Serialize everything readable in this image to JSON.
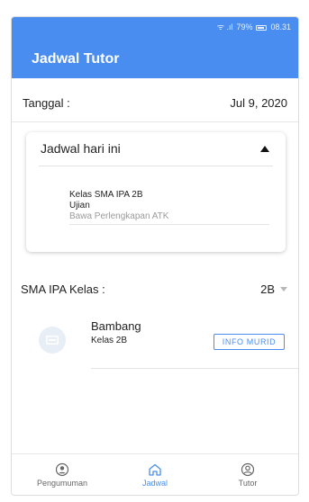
{
  "status_bar": {
    "signal_text": "ᯤ .ıl",
    "battery_percent": "79%",
    "time": "08.31"
  },
  "app_bar": {
    "title": "Jadwal Tutor"
  },
  "date_row": {
    "label": "Tanggal :",
    "value": "Jul 9, 2020"
  },
  "schedule_card": {
    "title": "Jadwal hari ini",
    "item": {
      "line1": "Kelas SMA IPA 2B",
      "line2": "Ujian",
      "line3": "Bawa Perlengkapan ATK"
    }
  },
  "class_filter": {
    "label": "SMA IPA Kelas :",
    "selected": "2B"
  },
  "students": [
    {
      "name": "Bambang",
      "class": "Kelas 2B",
      "button_label": "INFO MURID"
    }
  ],
  "bottom_nav": {
    "items": [
      {
        "label": "Pengumuman",
        "icon": "announcement-icon",
        "active": false
      },
      {
        "label": "Jadwal",
        "icon": "home-icon",
        "active": true
      },
      {
        "label": "Tutor",
        "icon": "account-icon",
        "active": false
      }
    ]
  },
  "colors": {
    "primary": "#4a8df0",
    "muted_text": "#9a9a9a"
  }
}
